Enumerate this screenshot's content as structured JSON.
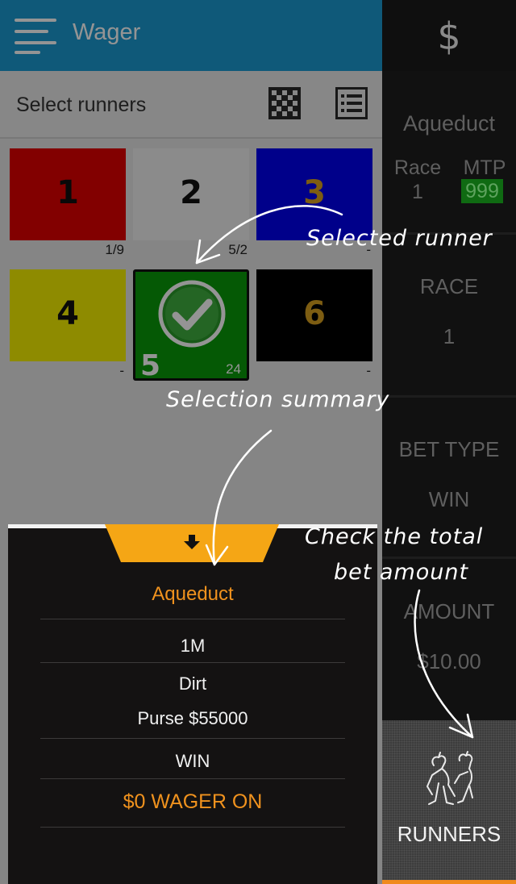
{
  "header": {
    "title": "Wager",
    "menu_icon": "hamburger-menu-icon"
  },
  "subheader": {
    "title": "Select runners",
    "grid_icon": "grid-view-icon",
    "list_icon": "list-view-icon"
  },
  "runners": [
    {
      "number": "1",
      "odds": "1/9",
      "color": "#e00000",
      "num_color": "#111111"
    },
    {
      "number": "2",
      "odds": "5/2",
      "color": "#f0f0f0",
      "num_color": "#111111"
    },
    {
      "number": "3",
      "odds": "-",
      "color": "#0000ee",
      "num_color": "#d8a020"
    },
    {
      "number": "4",
      "odds": "-",
      "color": "#f4f000",
      "num_color": "#111111"
    },
    {
      "number": "5",
      "odds": "24",
      "color": "#0a9a0a",
      "num_color": "#ffffff",
      "selected": true
    },
    {
      "number": "6",
      "odds": "-",
      "color": "#000000",
      "num_color": "#d8a020"
    }
  ],
  "summary": {
    "track": "Aqueduct",
    "distance": "1M",
    "surface": "Dirt",
    "purse": "Purse $55000",
    "bet_type": "WIN",
    "wager": "$0 WAGER ON",
    "accent_color": "#f0921e"
  },
  "sidebar": {
    "track": "Aqueduct",
    "race_label": "Race",
    "race_value": "1",
    "mtp_label": "MTP",
    "mtp_value": "999",
    "race_section_label": "RACE",
    "race_section_value": "1",
    "bet_type_label": "BET TYPE",
    "bet_type_value": "WIN",
    "amount_label": "AMOUNT",
    "amount_value": "$10.00",
    "runners_label": "RUNNERS",
    "dollar_icon": "$"
  },
  "annotations": {
    "selected_runner": "Selected runner",
    "selection_summary": "Selection summary",
    "check_total_line1": "Check the total",
    "check_total_line2": "bet amount"
  }
}
